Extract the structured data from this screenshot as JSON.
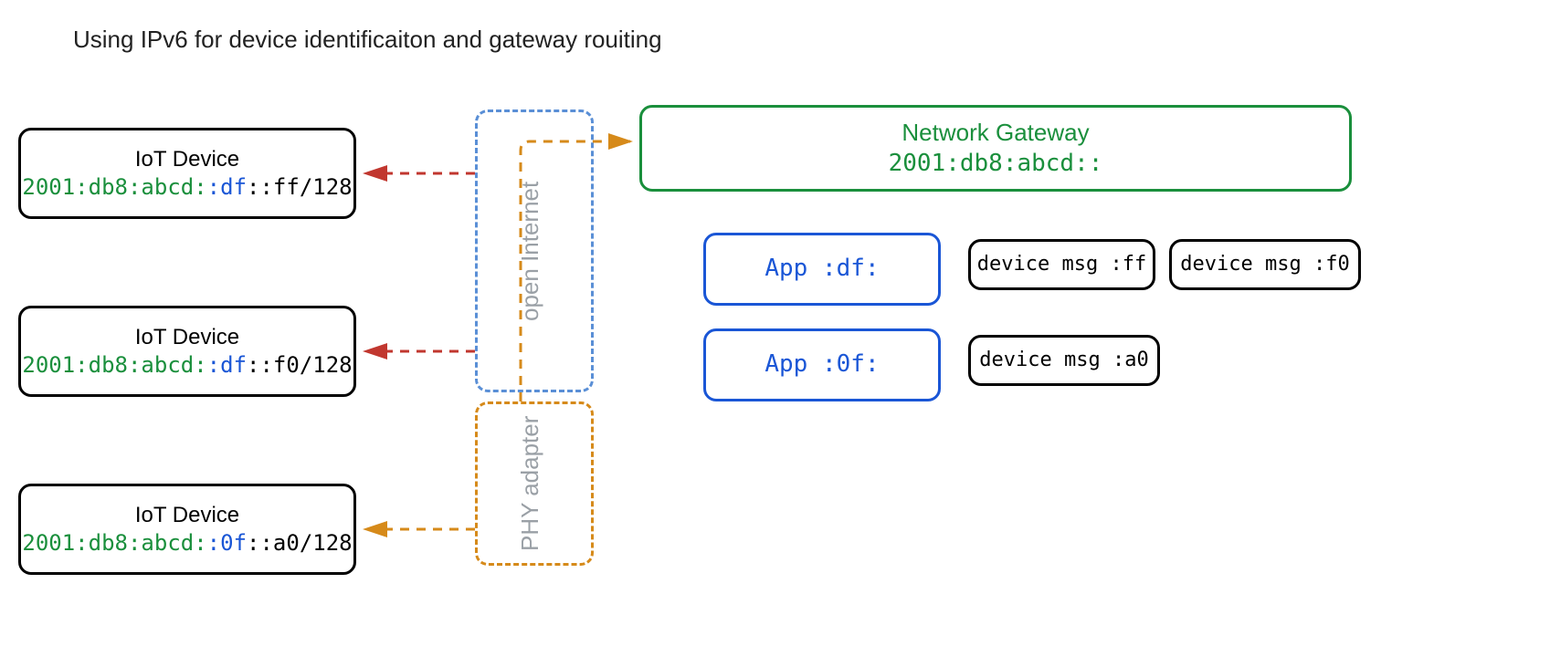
{
  "title": "Using IPv6 for device identificaiton and gateway rouiting",
  "devices": [
    {
      "label": "IoT Device",
      "addr_prefix": "2001:db8:abcd:",
      "addr_mid": ":df",
      "addr_suffix": "::ff/128"
    },
    {
      "label": "IoT Device",
      "addr_prefix": "2001:db8:abcd:",
      "addr_mid": ":df",
      "addr_suffix": "::f0/128"
    },
    {
      "label": "IoT Device",
      "addr_prefix": "2001:db8:abcd:",
      "addr_mid": ":0f",
      "addr_suffix": "::a0/128"
    }
  ],
  "regions": {
    "internet": "open Internet",
    "phy": "PHY adapter"
  },
  "gateway": {
    "title": "Network Gateway",
    "addr": "2001:db8:abcd::"
  },
  "apps": [
    {
      "label": "App :df:",
      "msgs": [
        "device msg :ff",
        "device msg :f0"
      ]
    },
    {
      "label": "App :0f:",
      "msgs": [
        "device msg :a0"
      ]
    }
  ],
  "colors": {
    "green": "#1a8f3c",
    "blue": "#1a56d6",
    "orange": "#d68a1a",
    "red": "#c1372f",
    "softblue": "#5a8fd6",
    "grey": "#9aa0a6"
  }
}
